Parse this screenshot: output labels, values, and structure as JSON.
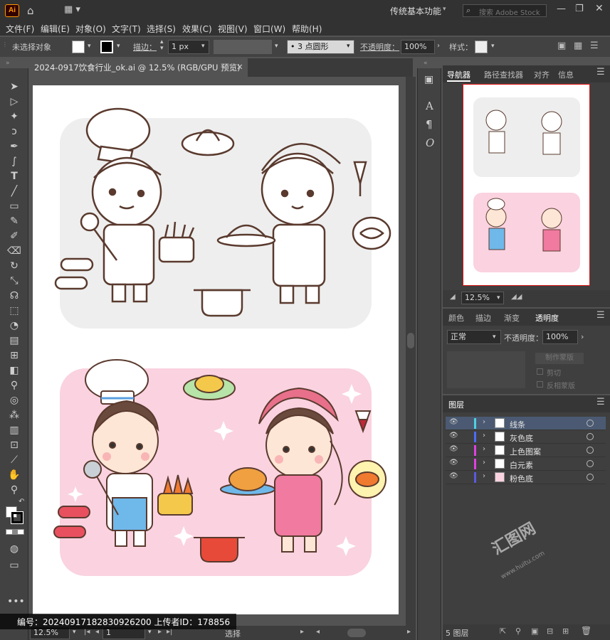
{
  "app": {
    "logo": "Ai",
    "workspace": "传统基本功能",
    "stock_search_placeholder": "搜索 Adobe Stock"
  },
  "menu": [
    "文件(F)",
    "编辑(E)",
    "对象(O)",
    "文字(T)",
    "选择(S)",
    "效果(C)",
    "视图(V)",
    "窗口(W)",
    "帮助(H)"
  ],
  "control": {
    "selection": "未选择对象",
    "stroke_label": "描边：",
    "stroke_value": "1 px",
    "brush": "3 点圆形",
    "opacity_label": "不透明度：",
    "opacity_value": "100%",
    "style_label": "样式："
  },
  "document": {
    "tab_title": "2024-0917饮食行业_ok.ai @ 12.5% (RGB/GPU 预览)"
  },
  "status": {
    "zoom": "12.5%",
    "artboard": "1",
    "tool": "选择"
  },
  "watermark": {
    "id_text": "编号：20240917182830926200  上传者ID：178856",
    "site": "www.huitu.com"
  },
  "navigator": {
    "tabs": [
      "导航器",
      "路径查找器",
      "对齐",
      "信息"
    ],
    "zoom": "12.5%"
  },
  "transparency": {
    "tabs": [
      "颜色",
      "描边",
      "渐变",
      "透明度"
    ],
    "blend_mode": "正常",
    "opacity_label": "不透明度：",
    "opacity_value": "100%",
    "make_mask": "制作蒙版",
    "clip": "剪切",
    "invert_mask": "反相蒙版"
  },
  "layers": {
    "title": "图层",
    "items": [
      {
        "name": "线条",
        "color": "#4fd1e0",
        "selected": true
      },
      {
        "name": "灰色底",
        "color": "#4a6cff",
        "selected": false
      },
      {
        "name": "上色图案",
        "color": "#e040e0",
        "selected": false
      },
      {
        "name": "白元素",
        "color": "#e040e0",
        "selected": false
      },
      {
        "name": "粉色底",
        "color": "#5a5adf",
        "selected": false
      }
    ],
    "count_text": "5 图层"
  },
  "colors": {
    "pink_bg": "#fad2e0",
    "gray_bg": "#eeeeee",
    "line": "#5a3a2e"
  }
}
